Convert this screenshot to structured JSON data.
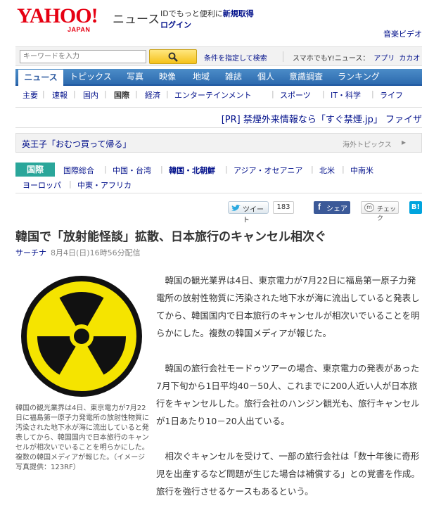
{
  "header": {
    "logo_main": "YAHOO!",
    "logo_sub": "JAPAN",
    "news_label": "ニュース",
    "id_text": "IDでもっと便利に",
    "register_label": "新規取得",
    "login_label": "ログイン",
    "links": "音楽ビデオ"
  },
  "search": {
    "placeholder": "キーワードを入力",
    "conditions_label": "条件を指定して検索",
    "smartphone_text": "スマホでもY!ニュース：",
    "app_label": "アプリ",
    "other_label": "カカオ"
  },
  "nav": {
    "items": [
      "ニュース",
      "トピックス",
      "写真",
      "映像",
      "地域",
      "雑誌",
      "個人",
      "意識調査",
      "ランキング"
    ]
  },
  "subnav": {
    "items": [
      "主要",
      "速報",
      "国内",
      "国際",
      "経済",
      "エンターテインメント",
      "スポーツ",
      "IT・科学",
      "ライフ"
    ]
  },
  "pr": {
    "text": "[PR] 禁煙外来情報なら「すぐ禁煙.jp」 ファイザ"
  },
  "topic": {
    "text": "英王子「おむつ買って帰る」",
    "overseas_label": "海外トピックス",
    "arrow": "▸"
  },
  "category": {
    "label": "国際",
    "row1": [
      "国際総合",
      "中国・台湾",
      "韓国・北朝鮮",
      "アジア・オセアニア",
      "北米",
      "中南米"
    ],
    "row2": [
      "ヨーロッパ",
      "中東・アフリカ"
    ]
  },
  "share": {
    "tweet_label": "ツイート",
    "tweet_count": "183",
    "facebook_label": "シェア",
    "check_label": "チェック",
    "hatena_label": "B!"
  },
  "article": {
    "title": "韓国で「放射能怪談」拡散、日本旅行のキャンセル相次ぐ",
    "source": "サーチナ",
    "date": "8月4日(日)16時56分配信",
    "caption": "韓国の観光業界は4日、東京電力が7月22日に福島第一原子力発電所の放射性物質に汚染された地下水が海に流出していると発表してから、韓国国内で日本旅行のキャンセルが相次いでいることを明らかにした。複数の韓国メディアが報じた。（イメージ写真提供：123RF）",
    "paragraphs": [
      "韓国の観光業界は4日、東京電力が7月22日に福島第一原子力発電所の放射性物質に汚染された地下水が海に流出していると発表してから、韓国国内で日本旅行のキャンセルが相次いでいることを明らかにした。複数の韓国メディアが報じた。",
      "韓国の旅行会社モードゥツアーの場合、東京電力の発表があった7月下旬から1日平均40－50人、これまでに200人近い人が日本旅行をキャンセルした。旅行会社のハンジン観光も、旅行キャンセルが1日あたり10－20人出ている。",
      "相次ぐキャンセルを受けて、一部の旅行会社は「数十年後に奇形児を出産するなど問題が生じた場合は補償する」との覚書を作成。旅行を強行させるケースもあるという。"
    ]
  },
  "colors": {
    "brand_red": "#e60012",
    "nav_blue": "#2d6aae",
    "link_blue": "#000f8a",
    "category_green": "#2aa69a",
    "radiation_yellow": "#f5e400"
  }
}
